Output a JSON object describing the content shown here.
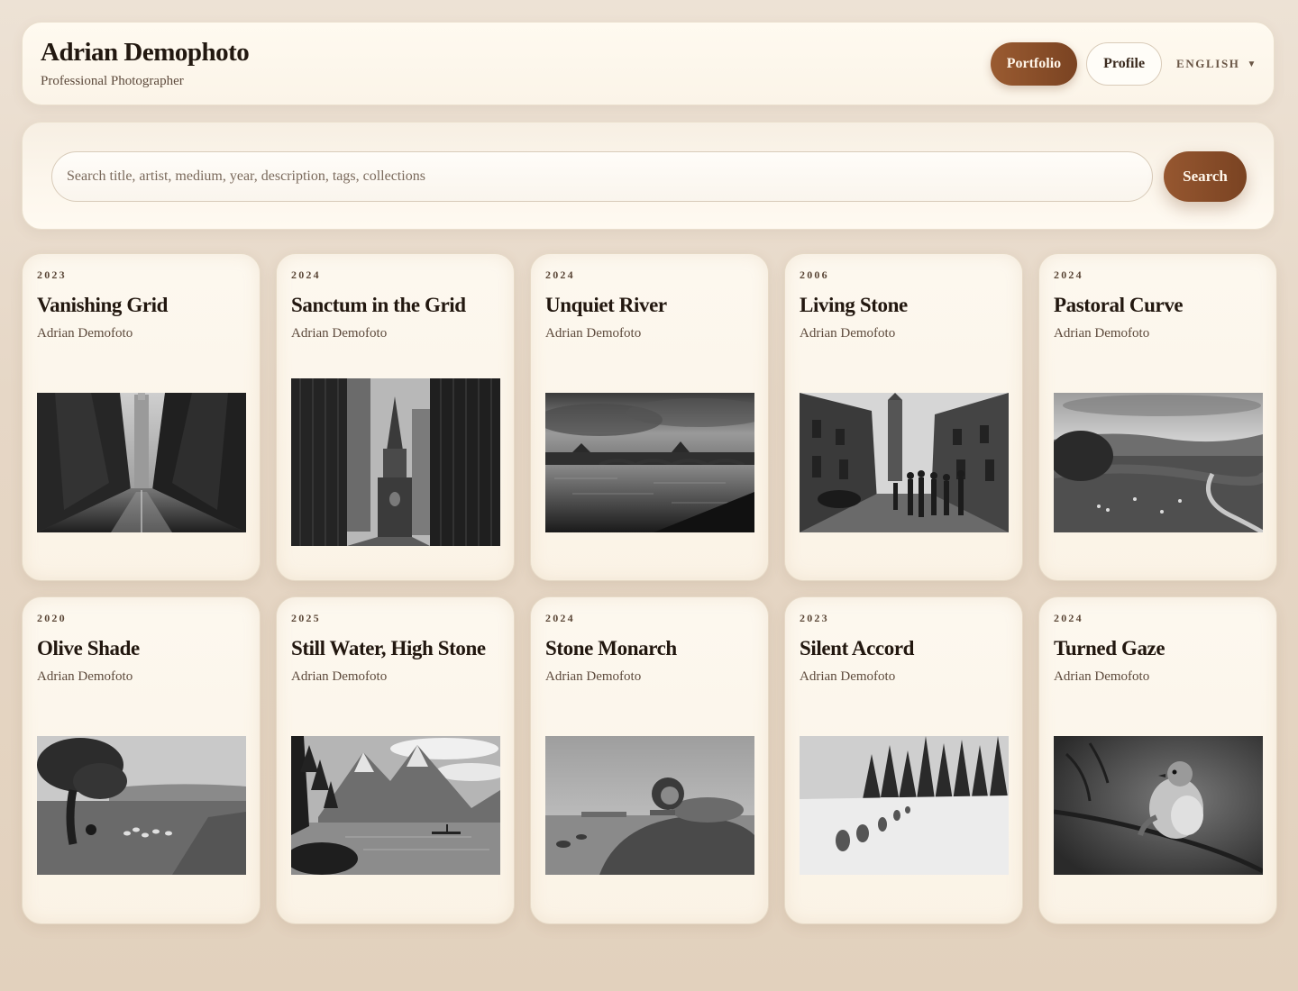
{
  "header": {
    "title": "Adrian Demophoto",
    "subtitle": "Professional Photographer",
    "nav": {
      "portfolio_label": "Portfolio",
      "profile_label": "Profile",
      "language_label": "ENGLISH",
      "language_caret": "▼"
    }
  },
  "search": {
    "placeholder": "Search title, artist, medium, year, description, tags, collections",
    "button_label": "Search"
  },
  "artworks": [
    {
      "year": "2023",
      "title": "Vanishing Grid",
      "artist": "Adrian Demofoto",
      "image_icon": "city-street-photo"
    },
    {
      "year": "2024",
      "title": "Sanctum in the Grid",
      "artist": "Adrian Demofoto",
      "image_icon": "cathedral-photo"
    },
    {
      "year": "2024",
      "title": "Unquiet River",
      "artist": "Adrian Demofoto",
      "image_icon": "river-photo"
    },
    {
      "year": "2006",
      "title": "Living Stone",
      "artist": "Adrian Demofoto",
      "image_icon": "old-town-street-photo"
    },
    {
      "year": "2024",
      "title": "Pastoral Curve",
      "artist": "Adrian Demofoto",
      "image_icon": "countryside-photo"
    },
    {
      "year": "2020",
      "title": "Olive Shade",
      "artist": "Adrian Demofoto",
      "image_icon": "olive-tree-photo"
    },
    {
      "year": "2025",
      "title": "Still Water, High Stone",
      "artist": "Adrian Demofoto",
      "image_icon": "mountain-lake-photo"
    },
    {
      "year": "2024",
      "title": "Stone Monarch",
      "artist": "Adrian Demofoto",
      "image_icon": "lion-photo"
    },
    {
      "year": "2023",
      "title": "Silent Accord",
      "artist": "Adrian Demofoto",
      "image_icon": "wolves-snow-photo"
    },
    {
      "year": "2024",
      "title": "Turned Gaze",
      "artist": "Adrian Demofoto",
      "image_icon": "bird-photo"
    }
  ],
  "colors": {
    "accent": "#8a4d28",
    "background": "#e6d7c6",
    "card": "#fcf5ea"
  }
}
